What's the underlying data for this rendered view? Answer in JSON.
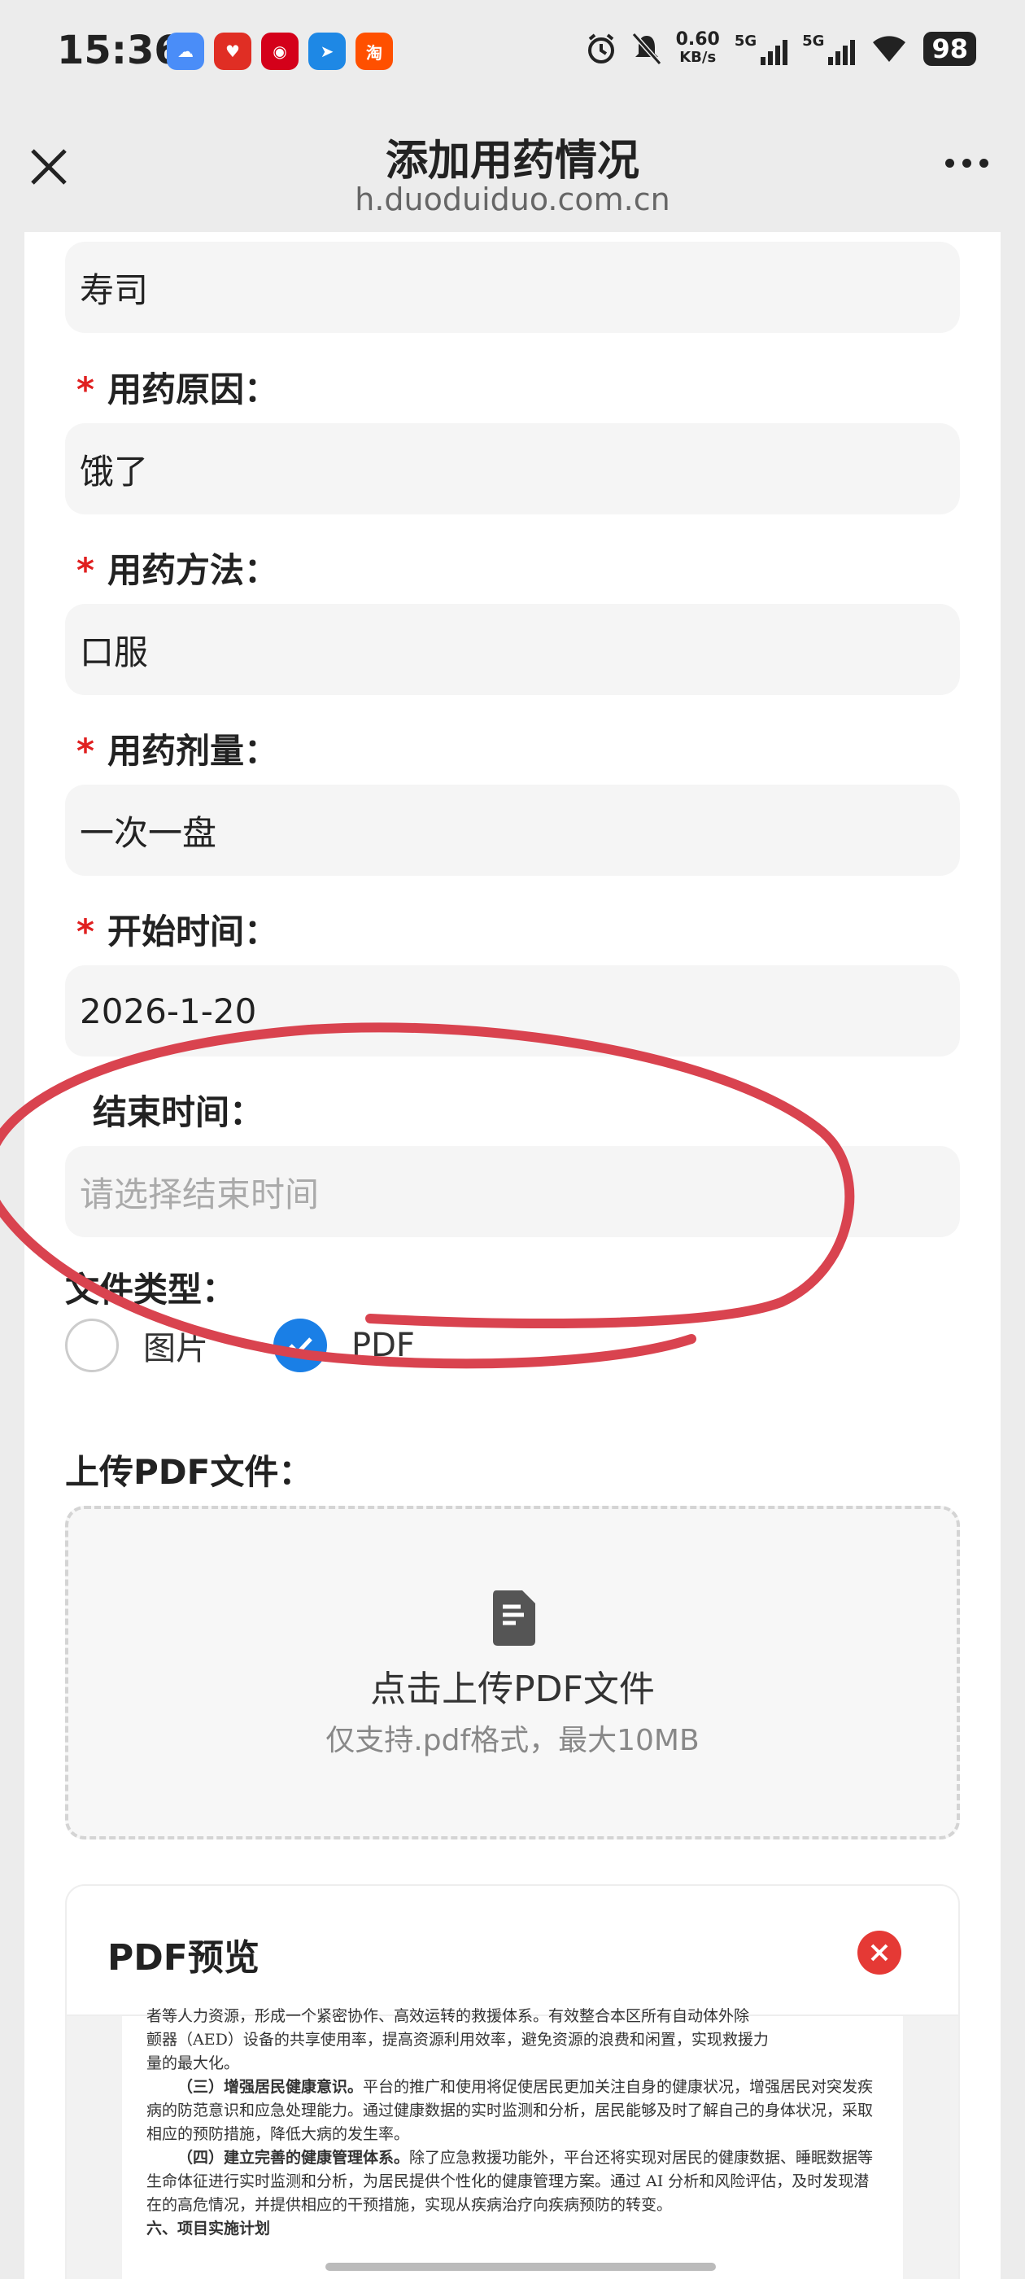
{
  "status_bar": {
    "time": "15:36",
    "net_speed_value": "0.60",
    "net_speed_unit": "KB/s",
    "signal1": "5G",
    "signal2": "5G",
    "battery": "98",
    "app_icons": [
      {
        "name": "baidu-netdisk-icon",
        "color": "#4a8df8"
      },
      {
        "name": "pinduoduo-icon",
        "color": "#e02e24"
      },
      {
        "name": "tmall-icon",
        "color": "#d4001a"
      },
      {
        "name": "dingtalk-icon",
        "color": "#1e88e5"
      },
      {
        "name": "taobao-icon",
        "color": "#ff5000"
      }
    ]
  },
  "nav": {
    "title": "添加用药情况",
    "subtitle": "h.duoduiduo.com.cn"
  },
  "form": {
    "drug_name_value": "寿司",
    "reason_label": "用药原因：",
    "reason_value": "饿了",
    "method_label": "用药方法：",
    "method_value": "口服",
    "dose_label": "用药剂量：",
    "dose_value": "一次一盘",
    "start_label": "开始时间：",
    "start_value": "2026-1-20",
    "end_label": "结束时间：",
    "end_placeholder": "请选择结束时间",
    "required_mark": "*",
    "file_type_label": "文件类型：",
    "file_type_options": [
      {
        "label": "图片",
        "checked": false
      },
      {
        "label": "PDF",
        "checked": true
      }
    ]
  },
  "upload": {
    "label": "上传PDF文件：",
    "title": "点击上传PDF文件",
    "hint": "仅支持.pdf格式，最大10MB"
  },
  "preview": {
    "title": "PDF预览",
    "lines": [
      "者等人力资源，形成一个紧密协作、高效运转的救援体系。有效整合本区所有自动体外除",
      "颤器（AED）设备的共享使用率，提高资源利用效率，避免资源的浪费和闲置，实现救援力",
      "量的最大化。"
    ],
    "sections": [
      {
        "heading": "（三）增强居民健康意识。",
        "text": "平台的推广和使用将促使居民更加关注自身的健康状况，增强居民对突发疾病的防范意识和应急处理能力。通过健康数据的实时监测和分析，居民能够及时了解自己的身体状况，采取相应的预防措施，降低大病的发生率。"
      },
      {
        "heading": "（四）建立完善的健康管理体系。",
        "text": "除了应急救援功能外，平台还将实现对居民的健康数据、睡眠数据等生命体征进行实时监测和分析，为居民提供个性化的健康管理方案。通过 AI 分析和风险评估，及时发现潜在的高危情况，并提供相应的干预措施，实现从疾病治疗向疾病预防的转变。"
      }
    ],
    "footer_heading": "六、项目实施计划"
  },
  "annotation": {
    "color": "#d9434f"
  }
}
